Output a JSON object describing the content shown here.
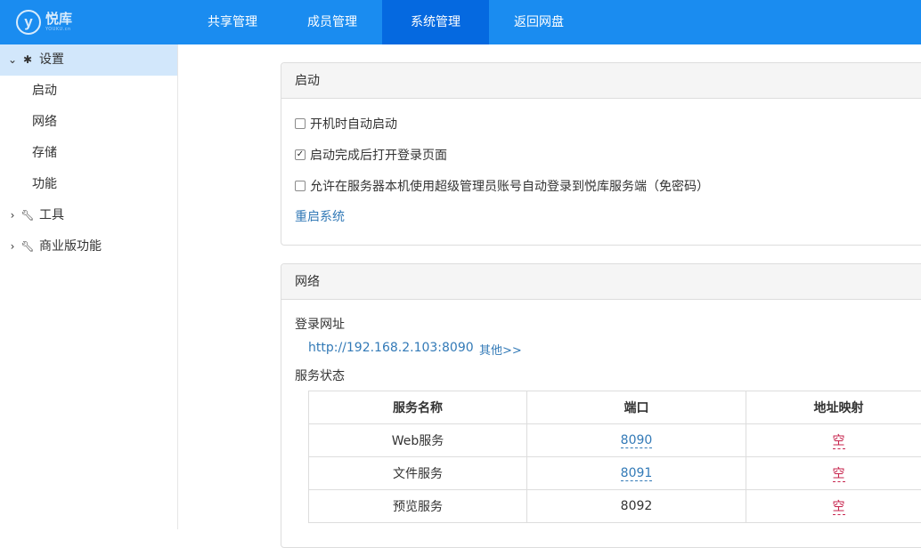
{
  "logo": {
    "mark": "y",
    "name": "悦库",
    "sub": "YOUKU.cn"
  },
  "nav": [
    {
      "label": "共享管理"
    },
    {
      "label": "成员管理"
    },
    {
      "label": "系统管理",
      "active": true
    },
    {
      "label": "返回网盘"
    }
  ],
  "sidebar": {
    "settings": {
      "label": "设置",
      "icon": "gear-icon",
      "expanded": true
    },
    "sub_items": [
      {
        "label": "启动"
      },
      {
        "label": "网络"
      },
      {
        "label": "存储"
      },
      {
        "label": "功能"
      }
    ],
    "tools": {
      "label": "工具",
      "icon": "wrench-icon"
    },
    "business": {
      "label": "商业版功能",
      "icon": "wrench-icon"
    }
  },
  "startup": {
    "title": "启动",
    "options": [
      {
        "label": "开机时自动启动",
        "checked": false
      },
      {
        "label": "启动完成后打开登录页面",
        "checked": true
      },
      {
        "label": "允许在服务器本机使用超级管理员账号自动登录到悦库服务端（免密码）",
        "checked": false
      }
    ],
    "restart_label": "重启系统"
  },
  "network": {
    "title": "网络",
    "login_url_label": "登录网址",
    "login_url": "http://192.168.2.103:8090",
    "more_label": "其他>>",
    "service_status_label": "服务状态",
    "table": {
      "headers": [
        "服务名称",
        "端口",
        "地址映射"
      ],
      "rows": [
        {
          "name": "Web服务",
          "port": "8090",
          "port_link": true,
          "mapping": "空"
        },
        {
          "name": "文件服务",
          "port": "8091",
          "port_link": true,
          "mapping": "空"
        },
        {
          "name": "预览服务",
          "port": "8092",
          "port_link": false,
          "mapping": "空"
        }
      ]
    }
  },
  "colors": {
    "topbar": "#1a8cf0",
    "nav_active": "#0569e0",
    "sidebar_active": "#d2e7fb",
    "link": "#337ab7",
    "empty": "#c7254e"
  }
}
